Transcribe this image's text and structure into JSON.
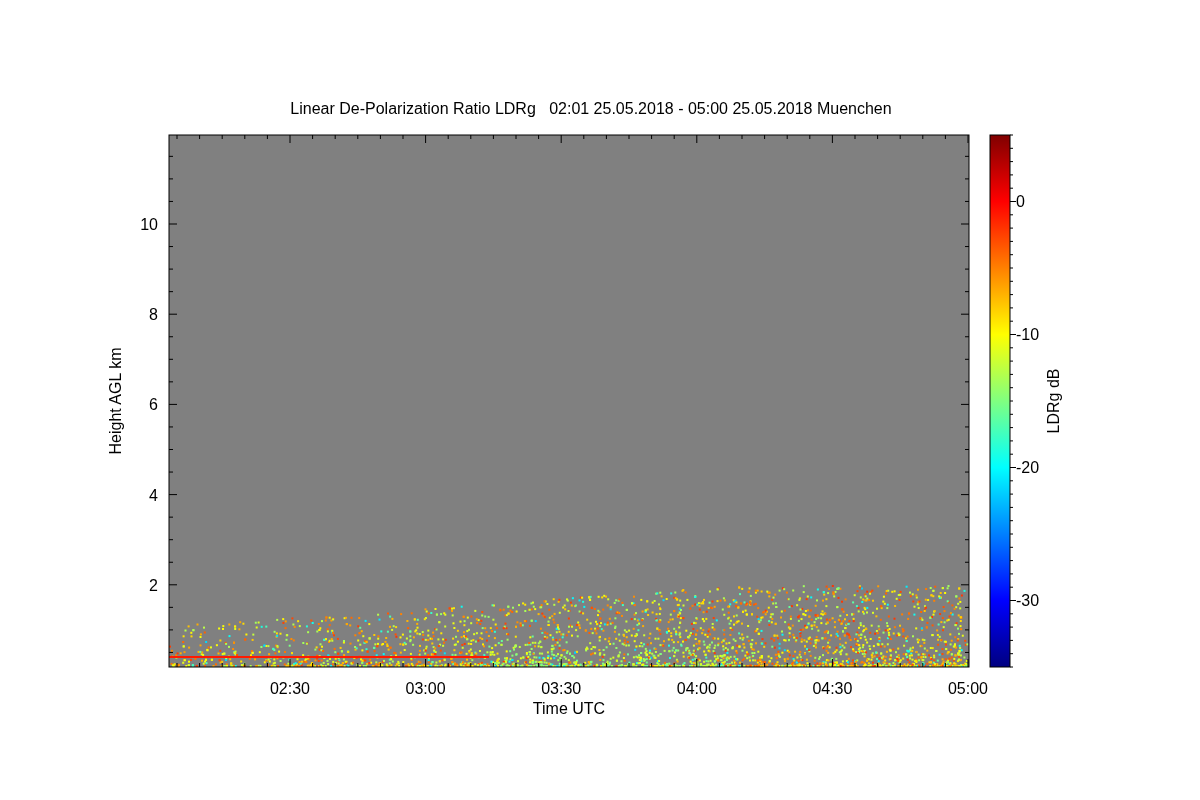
{
  "chart": {
    "title": "Linear De-Polarization Ratio LDRg   02:01 25.05.2018 - 05:00 25.05.2018 Muenchen",
    "xlabel": "Time UTC",
    "ylabel": "Height AGL km",
    "xticks": [
      "02:30",
      "03:00",
      "03:30",
      "04:00",
      "04:30",
      "05:00"
    ],
    "yticks": [
      "10",
      "8",
      "6",
      "4",
      "2"
    ]
  },
  "colorbar": {
    "label": "LDRg dB",
    "ticks": [
      "0",
      "-10",
      "-20",
      "-30"
    ]
  }
}
